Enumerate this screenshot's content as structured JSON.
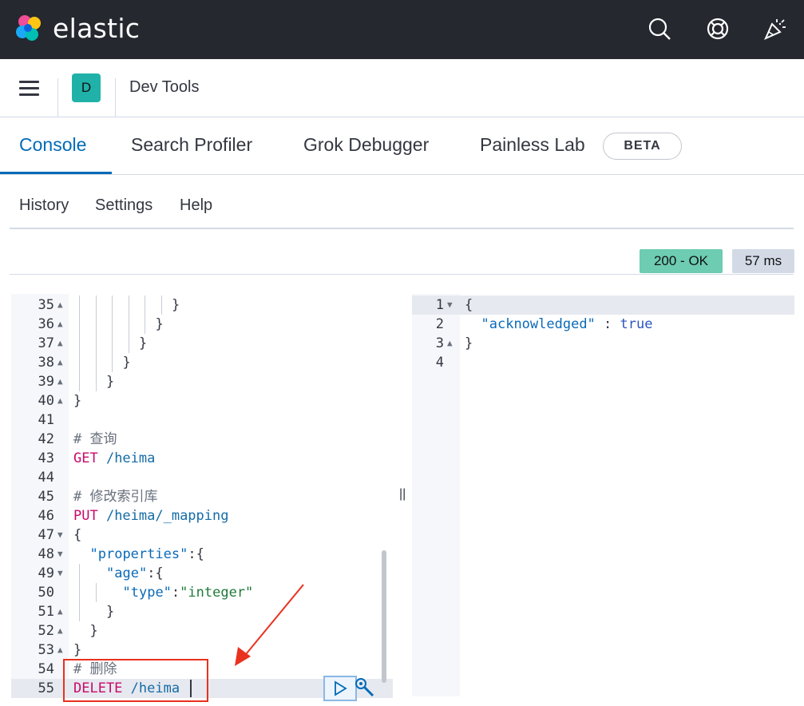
{
  "header": {
    "brand": "elastic"
  },
  "breadcrumb": {
    "avatar_letter": "D",
    "title": "Dev Tools"
  },
  "tabs": [
    {
      "label": "Console",
      "active": true
    },
    {
      "label": "Search Profiler",
      "active": false
    },
    {
      "label": "Grok Debugger",
      "active": false
    },
    {
      "label": "Painless Lab",
      "active": false
    }
  ],
  "beta_badge": "BETA",
  "submenu": {
    "history": "History",
    "settings": "Settings",
    "help": "Help"
  },
  "status": {
    "code": "200 - OK",
    "time": "57 ms"
  },
  "request_lines": [
    {
      "n": "35",
      "fold": "▲",
      "tokens": [
        {
          "t": "}",
          "c": "plain"
        }
      ]
    },
    {
      "n": "36",
      "fold": "▲",
      "tokens": [
        {
          "t": "}",
          "c": "plain"
        }
      ]
    },
    {
      "n": "37",
      "fold": "▲",
      "tokens": [
        {
          "t": "}",
          "c": "plain"
        }
      ]
    },
    {
      "n": "38",
      "fold": "▲",
      "tokens": [
        {
          "t": "}",
          "c": "plain"
        }
      ]
    },
    {
      "n": "39",
      "fold": "▲",
      "tokens": [
        {
          "t": "}",
          "c": "plain"
        }
      ]
    },
    {
      "n": "40",
      "fold": "▲",
      "tokens": [
        {
          "t": "}",
          "c": "plain"
        }
      ]
    },
    {
      "n": "41",
      "fold": "",
      "tokens": []
    },
    {
      "n": "42",
      "fold": "",
      "tokens": [
        {
          "t": "# 查询",
          "c": "kw-cmt"
        }
      ]
    },
    {
      "n": "43",
      "fold": "",
      "tokens": [
        {
          "t": "GET",
          "c": "kw-method"
        },
        {
          "t": " /heima",
          "c": "kw-url"
        }
      ]
    },
    {
      "n": "44",
      "fold": "",
      "tokens": []
    },
    {
      "n": "45",
      "fold": "",
      "tokens": [
        {
          "t": "# 修改索引库",
          "c": "kw-cmt"
        }
      ]
    },
    {
      "n": "46",
      "fold": "",
      "tokens": [
        {
          "t": "PUT",
          "c": "kw-method"
        },
        {
          "t": " /heima/_mapping",
          "c": "kw-url"
        }
      ]
    },
    {
      "n": "47",
      "fold": "▼",
      "tokens": [
        {
          "t": "{",
          "c": "plain"
        }
      ]
    },
    {
      "n": "48",
      "fold": "▼",
      "tokens": [
        {
          "t": "\"properties\"",
          "c": "kw-key"
        },
        {
          "t": ":{",
          "c": "plain"
        }
      ]
    },
    {
      "n": "49",
      "fold": "▼",
      "tokens": [
        {
          "t": "\"age\"",
          "c": "kw-key"
        },
        {
          "t": ":{",
          "c": "plain"
        }
      ]
    },
    {
      "n": "50",
      "fold": "",
      "tokens": [
        {
          "t": "\"type\"",
          "c": "kw-key"
        },
        {
          "t": ":",
          "c": "plain"
        },
        {
          "t": "\"integer\"",
          "c": "kw-str"
        }
      ]
    },
    {
      "n": "51",
      "fold": "▲",
      "tokens": [
        {
          "t": "}",
          "c": "plain"
        }
      ]
    },
    {
      "n": "52",
      "fold": "▲",
      "tokens": [
        {
          "t": "}",
          "c": "plain"
        }
      ]
    },
    {
      "n": "53",
      "fold": "▲",
      "tokens": [
        {
          "t": "}",
          "c": "plain"
        }
      ]
    },
    {
      "n": "54",
      "fold": "",
      "tokens": [
        {
          "t": "# 删除",
          "c": "kw-cmt"
        }
      ]
    },
    {
      "n": "55",
      "fold": "",
      "tokens": [
        {
          "t": "DELETE",
          "c": "kw-method"
        },
        {
          "t": " /heima",
          "c": "kw-url"
        }
      ]
    }
  ],
  "response_lines": [
    {
      "n": "1",
      "fold": "▼",
      "tokens": [
        {
          "t": "{",
          "c": "plain"
        }
      ]
    },
    {
      "n": "2",
      "fold": "",
      "tokens": [
        {
          "t": "\"acknowledged\"",
          "c": "kw-key"
        },
        {
          "t": " : ",
          "c": "plain"
        },
        {
          "t": "true",
          "c": "kw-bool"
        }
      ]
    },
    {
      "n": "3",
      "fold": "▲",
      "tokens": [
        {
          "t": "}",
          "c": "plain"
        }
      ]
    },
    {
      "n": "4",
      "fold": "",
      "tokens": []
    }
  ]
}
